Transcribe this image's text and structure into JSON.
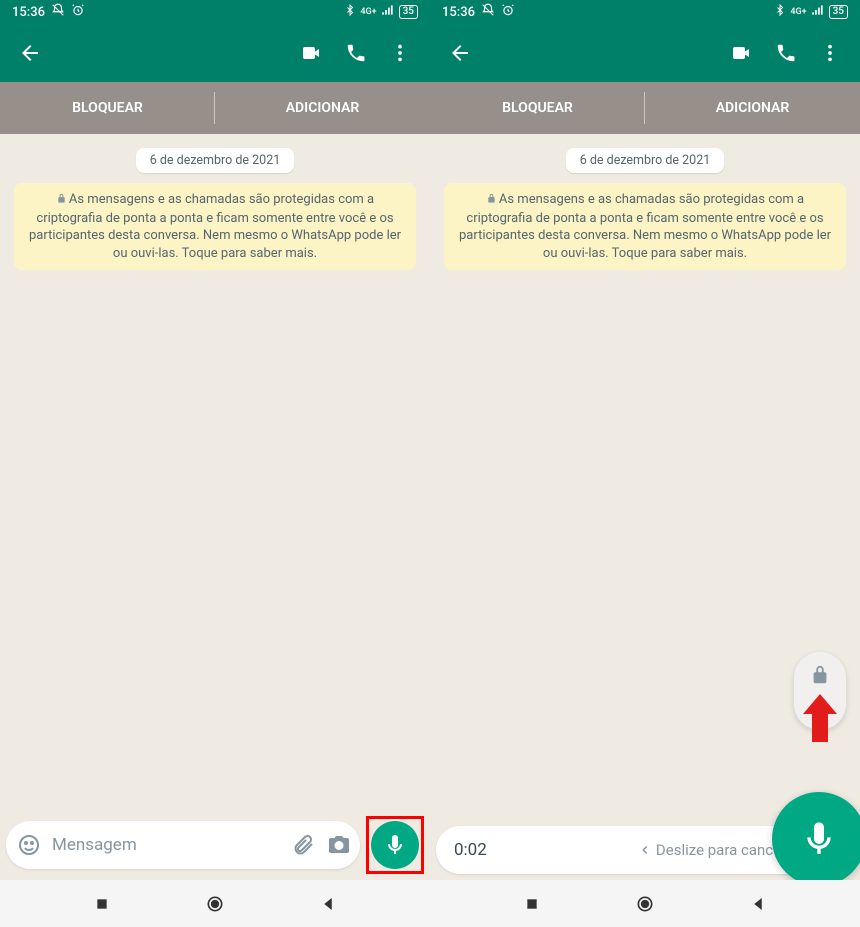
{
  "status": {
    "time": "15:36",
    "battery": "35"
  },
  "actions": {
    "block": "BLOQUEAR",
    "add": "ADICIONAR"
  },
  "chat": {
    "date": "6 de dezembro de 2021",
    "encryption": "As mensagens e as chamadas são protegidas com a criptografia de ponta a ponta e ficam somente entre você e os participantes desta conversa. Nem mesmo o WhatsApp pode ler ou ouvi-las. Toque para saber mais."
  },
  "input": {
    "placeholder": "Mensagem"
  },
  "recording": {
    "timer": "0:02",
    "slideHint": "Deslize para cancelar"
  }
}
